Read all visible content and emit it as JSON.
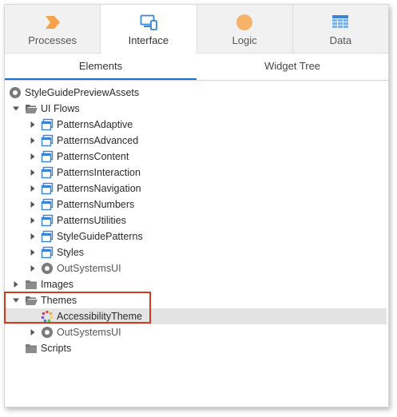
{
  "top_tabs": [
    {
      "label": "Processes",
      "icon": "processes-chevron-icon",
      "color": "#f5a24b"
    },
    {
      "label": "Interface",
      "icon": "devices-icon",
      "color": "#3a82d6"
    },
    {
      "label": "Logic",
      "icon": "logic-circle-icon",
      "color": "#f5b36a"
    },
    {
      "label": "Data",
      "icon": "data-grid-icon",
      "color": "#3a82d6"
    }
  ],
  "sub_tabs": [
    {
      "label": "Elements"
    },
    {
      "label": "Widget Tree"
    }
  ],
  "tree": [
    {
      "label": "StyleGuidePreviewAssets",
      "icon": "module-icon"
    },
    {
      "label": "UI Flows",
      "icon": "folder-open-icon",
      "toggle": "expanded"
    },
    {
      "label": "PatternsAdaptive",
      "icon": "ui-flow-icon",
      "toggle": "collapsed"
    },
    {
      "label": "PatternsAdvanced",
      "icon": "ui-flow-icon",
      "toggle": "collapsed"
    },
    {
      "label": "PatternsContent",
      "icon": "ui-flow-icon",
      "toggle": "collapsed"
    },
    {
      "label": "PatternsInteraction",
      "icon": "ui-flow-icon",
      "toggle": "collapsed"
    },
    {
      "label": "PatternsNavigation",
      "icon": "ui-flow-icon",
      "toggle": "collapsed"
    },
    {
      "label": "PatternsNumbers",
      "icon": "ui-flow-icon",
      "toggle": "collapsed"
    },
    {
      "label": "PatternsUtilities",
      "icon": "ui-flow-icon",
      "toggle": "collapsed"
    },
    {
      "label": "StyleGuidePatterns",
      "icon": "ui-flow-icon",
      "toggle": "collapsed"
    },
    {
      "label": "Styles",
      "icon": "ui-flow-icon",
      "toggle": "collapsed"
    },
    {
      "label": "OutSystemsUI",
      "icon": "module-reference-icon",
      "toggle": "collapsed"
    },
    {
      "label": "Images",
      "icon": "folder-icon",
      "toggle": "collapsed"
    },
    {
      "label": "Themes",
      "icon": "folder-open-icon",
      "toggle": "expanded"
    },
    {
      "label": "AccessibilityTheme",
      "icon": "theme-icon",
      "selected": true
    },
    {
      "label": "OutSystemsUI",
      "icon": "module-reference-icon",
      "toggle": "collapsed"
    },
    {
      "label": "Scripts",
      "icon": "folder-icon"
    }
  ],
  "colors": {
    "accent": "#1f6fd1",
    "highlight_border": "#d23a1e",
    "selected_row": "#e4e4e4"
  }
}
